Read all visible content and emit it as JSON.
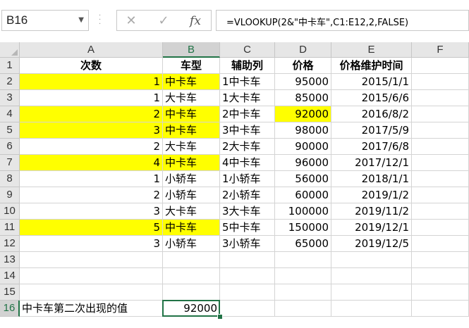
{
  "name_box": {
    "value": "B16"
  },
  "formula_bar": {
    "cancel_icon": "✕",
    "enter_icon": "✓",
    "fx_label": "fx",
    "formula": "=VLOOKUP(2&\"中卡车\",C1:E12,2,FALSE)"
  },
  "columns": [
    "A",
    "B",
    "C",
    "D",
    "E",
    "F"
  ],
  "active_column": "B",
  "active_row": "16",
  "rows": [
    {
      "num": "1",
      "a": "次数",
      "b": "车型",
      "c": "辅助列",
      "d": "价格",
      "e": "价格维护时间"
    },
    {
      "num": "2",
      "a": "1",
      "b": "中卡车",
      "c": "1中卡车",
      "d": "95000",
      "e": "2015/1/1"
    },
    {
      "num": "3",
      "a": "1",
      "b": "大卡车",
      "c": "1大卡车",
      "d": "85000",
      "e": "2015/6/6"
    },
    {
      "num": "4",
      "a": "2",
      "b": "中卡车",
      "c": "2中卡车",
      "d": "92000",
      "e": "2016/8/2"
    },
    {
      "num": "5",
      "a": "3",
      "b": "中卡车",
      "c": "3中卡车",
      "d": "98000",
      "e": "2017/5/9"
    },
    {
      "num": "6",
      "a": "2",
      "b": "大卡车",
      "c": "2大卡车",
      "d": "90000",
      "e": "2017/6/8"
    },
    {
      "num": "7",
      "a": "4",
      "b": "中卡车",
      "c": "4中卡车",
      "d": "96000",
      "e": "2017/12/1"
    },
    {
      "num": "8",
      "a": "1",
      "b": "小轿车",
      "c": "1小轿车",
      "d": "56000",
      "e": "2018/1/1"
    },
    {
      "num": "9",
      "a": "2",
      "b": "小轿车",
      "c": "2小轿车",
      "d": "60000",
      "e": "2019/1/2"
    },
    {
      "num": "10",
      "a": "3",
      "b": "大卡车",
      "c": "3大卡车",
      "d": "100000",
      "e": "2019/11/2"
    },
    {
      "num": "11",
      "a": "5",
      "b": "中卡车",
      "c": "5中卡车",
      "d": "150000",
      "e": "2019/12/1"
    },
    {
      "num": "12",
      "a": "3",
      "b": "小轿车",
      "c": "3小轿车",
      "d": "65000",
      "e": "2019/12/5"
    },
    {
      "num": "13",
      "a": "",
      "b": "",
      "c": "",
      "d": "",
      "e": ""
    },
    {
      "num": "14",
      "a": "",
      "b": "",
      "c": "",
      "d": "",
      "e": ""
    },
    {
      "num": "15",
      "a": "",
      "b": "",
      "c": "",
      "d": "",
      "e": ""
    },
    {
      "num": "16",
      "a": "中卡车第二次出现的值",
      "b": "92000",
      "c": "",
      "d": "",
      "e": ""
    }
  ],
  "highlight_color": "#ffff00",
  "accent_color": "#217346"
}
